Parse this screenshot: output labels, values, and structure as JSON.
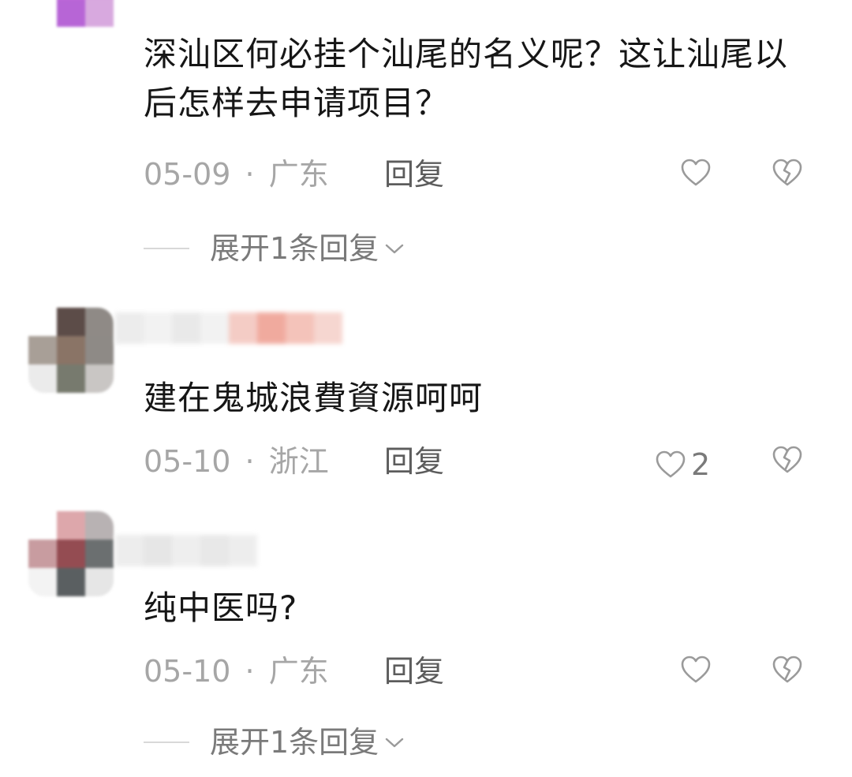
{
  "comments": [
    {
      "text": "深汕区何必挂个汕尾的名义呢？这让汕尾以后怎样去申请项目？",
      "date": "05-09",
      "location": "广东",
      "separator": "·",
      "reply_label": "回复",
      "like_count": "",
      "expand_label": "展开1条回复"
    },
    {
      "text": "建在鬼城浪費資源呵呵",
      "date": "05-10",
      "location": "浙江",
      "separator": "·",
      "reply_label": "回复",
      "like_count": "2",
      "expand_label": ""
    },
    {
      "text": "纯中医吗?",
      "date": "05-10",
      "location": "广东",
      "separator": "·",
      "reply_label": "回复",
      "like_count": "",
      "expand_label": "展开1条回复"
    }
  ],
  "icons": {
    "like": "heart-outline-icon",
    "dislike": "broken-heart-icon",
    "expand": "chevron-down-icon"
  },
  "colors": {
    "meta_text": "#a6a6a6",
    "reply_text": "#5c5c5c",
    "icon_stroke": "#9a9a9a",
    "avatar1": [
      "#ffffff",
      "#e77ae8",
      "#d98ad9",
      "#ffffff",
      "#b765d6",
      "#d8a9df",
      "#ffffff",
      "#ffffff",
      "#ffffff"
    ],
    "avatar2": [
      "#ffffff",
      "#5c4c48",
      "#8f8a86",
      "#a89f97",
      "#8a7466",
      "#8e8a86",
      "#ebebeb",
      "#777a6e",
      "#c9c6c4"
    ],
    "avatar3": [
      "#ffffff",
      "#dda7ab",
      "#b8b2b3",
      "#c89ca0",
      "#944c52",
      "#6b6f70",
      "#f3f3f3",
      "#5a5f61",
      "#e6e6e6"
    ],
    "username2": [
      "#e9e9e9",
      "#f0f0f0",
      "#e6e6e6",
      "#f0f0f0",
      "#f3c4bc",
      "#ee9c8e",
      "#f3b9ae",
      "#f5cfc8"
    ],
    "username3": [
      "#eaeaea",
      "#e2e2e2",
      "#ececec",
      "#e4e4e4",
      "#ebebeb"
    ]
  }
}
